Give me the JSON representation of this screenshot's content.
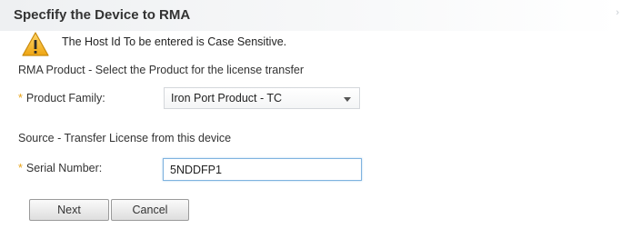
{
  "dialog": {
    "title": "Specfify the Device to RMA"
  },
  "warning": {
    "icon": "warning-triangle-icon",
    "text": "The Host Id To be entered is Case Sensitive."
  },
  "rma_product": {
    "section_label": "RMA Product - Select the Product for the license transfer",
    "product_family": {
      "label": "Product Family:",
      "required_marker": "*",
      "selected_value": "Iron Port Product - TC"
    }
  },
  "source": {
    "section_label": "Source - Transfer License from this device",
    "serial_number": {
      "label": "Serial Number:",
      "required_marker": "*",
      "value": "5NDDFP1"
    }
  },
  "actions": {
    "next_label": "Next",
    "cancel_label": "Cancel"
  },
  "colors": {
    "required_marker": "#e8a316",
    "warning_icon": "#f2b41d",
    "focused_input_border": "#7fb3df"
  }
}
